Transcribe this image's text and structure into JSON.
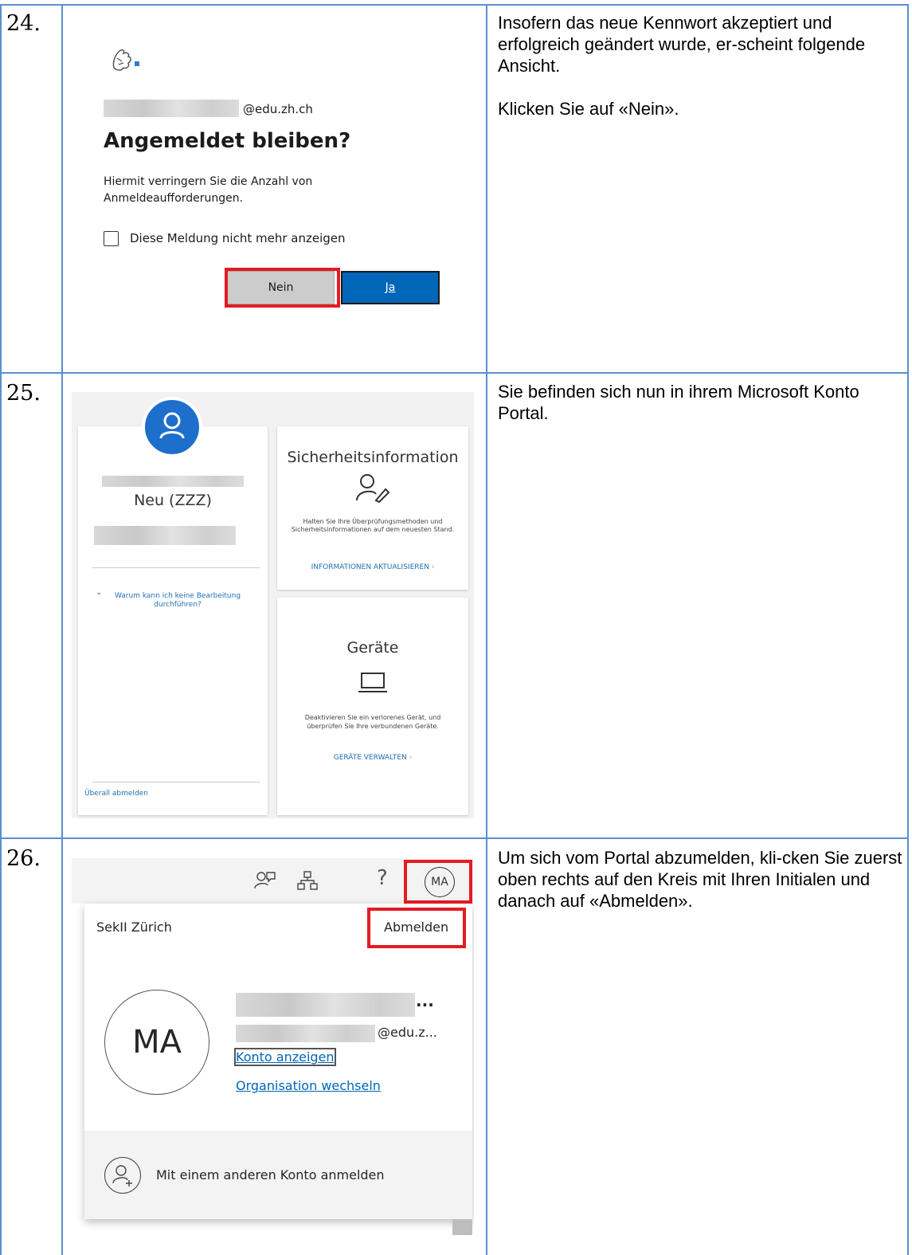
{
  "steps": [
    {
      "number": "24.",
      "text": [
        "Insofern das neue Kennwort akzeptiert und erfolgreich geändert wurde, er-scheint folgende Ansicht.",
        "Klicken Sie auf «Nein»."
      ],
      "screenshot": {
        "email_suffix": "@edu.zh.ch",
        "heading": "Angemeldet bleiben?",
        "body": "Hiermit verringern Sie die Anzahl von Anmeldeaufforderungen.",
        "checkbox_label": "Diese Meldung nicht mehr anzeigen",
        "no_button": "Nein",
        "yes_button": "Ja"
      }
    },
    {
      "number": "25.",
      "text": [
        "Sie befinden sich nun in ihrem Microsoft Konto Portal."
      ],
      "screenshot": {
        "profile_name": "Neu (ZZZ)",
        "why_link": "Warum kann ich keine Bearbeitung durchführen?",
        "signout_everywhere": "Überall abmelden",
        "security_title": "Sicherheitsinformation",
        "security_body": "Halten Sie Ihre Überprüfungsmethoden und Sicherheitsinformationen auf dem neuesten Stand.",
        "security_link": "INFORMATIONEN AKTUALISIEREN",
        "devices_title": "Geräte",
        "devices_body": "Deaktivieren Sie ein verlorenes Gerät, und überprüfen Sie Ihre verbundenen Geräte.",
        "devices_link": "GERÄTE VERWALTEN"
      }
    },
    {
      "number": "26.",
      "text": [
        "Um sich vom Portal abzumelden, kli-cken Sie zuerst oben rechts auf den Kreis mit Ihren Initialen und danach auf «Abmelden»."
      ],
      "screenshot": {
        "initials": "MA",
        "help_glyph": "?",
        "org_name": "SekII Zürich",
        "signout": "Abmelden",
        "name_ellipsis": "...",
        "email_suffix": "@edu.z...",
        "view_account": "Konto anzeigen",
        "switch_org": "Organisation wechseln",
        "other_account": "Mit einem anderen Konto anmelden"
      }
    }
  ],
  "colors": {
    "grid": "#5b8fd0",
    "highlight": "#e41b23",
    "ms_blue": "#0067b8",
    "avatar_blue": "#1e6fcc"
  }
}
